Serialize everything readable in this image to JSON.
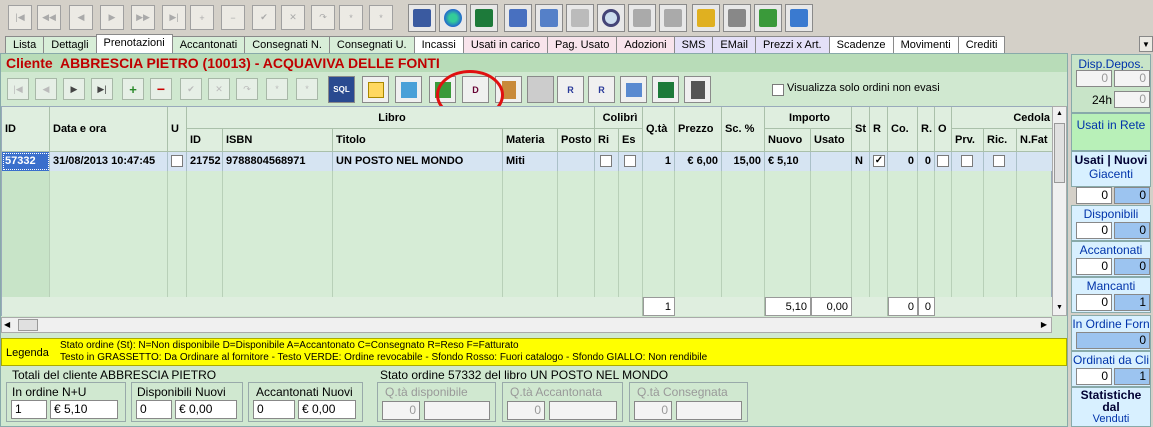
{
  "toolbar": {
    "nav": [
      "|◀",
      "◀◀",
      "◀",
      "▶",
      "▶▶",
      "▶|",
      "+",
      "−",
      "✔",
      "✕",
      "↷",
      "*",
      "*"
    ]
  },
  "tabs": [
    "Lista",
    "Dettagli",
    "Prenotazioni",
    "Accantonati",
    "Consegnati N.",
    "Consegnati U.",
    "Incassi",
    "Usati in carico",
    "Pag. Usato",
    "Adozioni",
    "SMS",
    "EMail",
    "Prezzi x Art.",
    "Scadenze",
    "Movimenti",
    "Crediti"
  ],
  "active_tab": "Prenotazioni",
  "cliente": {
    "label": "Cliente",
    "name": "ABBRESCIA PIETRO (10013) - ACQUAVIVA DELLE FONTI"
  },
  "subtoolbar": {
    "sql_label": "SQL",
    "d_label": "D",
    "only_open_label": "Visualizza solo ordini non evasi"
  },
  "grid": {
    "headers": {
      "id": "ID",
      "data": "Data e ora",
      "u": "U",
      "libro": "Libro",
      "libro_id": "ID",
      "isbn": "ISBN",
      "titolo": "Titolo",
      "materia": "Materia",
      "posto": "Posto",
      "colibri": "Colibrì",
      "ri": "Ri",
      "es": "Es",
      "qta": "Q.tà",
      "prezzo": "Prezzo",
      "sc": "Sc. %",
      "importo": "Importo",
      "nuovo": "Nuovo",
      "usato": "Usato",
      "st": "St",
      "r": "R",
      "co": "Co.",
      "r2": "R.",
      "o": "O",
      "cedola": "Cedola",
      "prv": "Prv.",
      "ric": "Ric.",
      "nfat": "N.Fat"
    },
    "rows": [
      {
        "id": "57332",
        "data": "31/08/2013 10:47:45",
        "libro_id": "21752",
        "isbn": "9788804568971",
        "titolo": "UN POSTO NEL MONDO",
        "materia": "Miti",
        "qta": "1",
        "prezzo": "€ 6,00",
        "sc": "15,00",
        "nuovo": "€ 5,10",
        "st": "N",
        "co": "0",
        "r2": "0"
      }
    ],
    "totals": {
      "qta": "1",
      "nuovo": "5,10",
      "usato": "0,00",
      "co": "0",
      "r2": "0"
    }
  },
  "legend": {
    "label": "Legenda",
    "line1": "Stato ordine (St): N=Non disponibile  D=Disponibile  A=Accantonato  C=Consegnato R=Reso  F=Fatturato",
    "line2": "Testo in GRASSETTO: Da Ordinare al fornitore - Testo VERDE: Ordine revocabile - Sfondo Rosso: Fuori catalogo - Sfondo GIALLO: Non rendibile"
  },
  "totali": {
    "title": "Totali del cliente ABBRESCIA PIETRO",
    "in_ordine_label": "In ordine N+U",
    "in_ordine_qta": "1",
    "in_ordine_val": "€ 5,10",
    "disp_label": "Disponibili Nuovi",
    "disp_qta": "0",
    "disp_val": "€ 0,00",
    "acc_label": "Accantonati Nuovi",
    "acc_qta": "0",
    "acc_val": "€ 0,00"
  },
  "stato": {
    "title": "Stato ordine 57332 del libro UN POSTO NEL MONDO",
    "disp_label": "Q.tà disponibile",
    "disp_val": "0",
    "acc_label": "Q.tà Accantonata",
    "acc_val": "0",
    "cons_label": "Q.tà Consegnata",
    "cons_val": "0"
  },
  "sidebar": {
    "disp_depos": "Disp.Depos.",
    "disp_a": "0",
    "disp_b": "0",
    "h24": "24h",
    "h24_val": "0",
    "usati_rete": "Usati in Rete",
    "usati_nuovi": "Usati | Nuovi",
    "giacenti": "Giacenti",
    "giac_u": "0",
    "giac_n": "0",
    "disponibili": "Disponibili",
    "disp_u": "0",
    "disp_n": "0",
    "accantonati": "Accantonati",
    "acc_u": "0",
    "acc_n": "0",
    "mancanti": "Mancanti",
    "manc_u": "0",
    "manc_n": "1",
    "in_ordine_forn": "In Ordine Forn",
    "in_ordine_forn_val": "0",
    "ordinati_cli": "Ordinati da Cli",
    "ord_u": "0",
    "ord_n": "1",
    "statistiche": "Statistiche dal",
    "venduti": "Venduti"
  }
}
